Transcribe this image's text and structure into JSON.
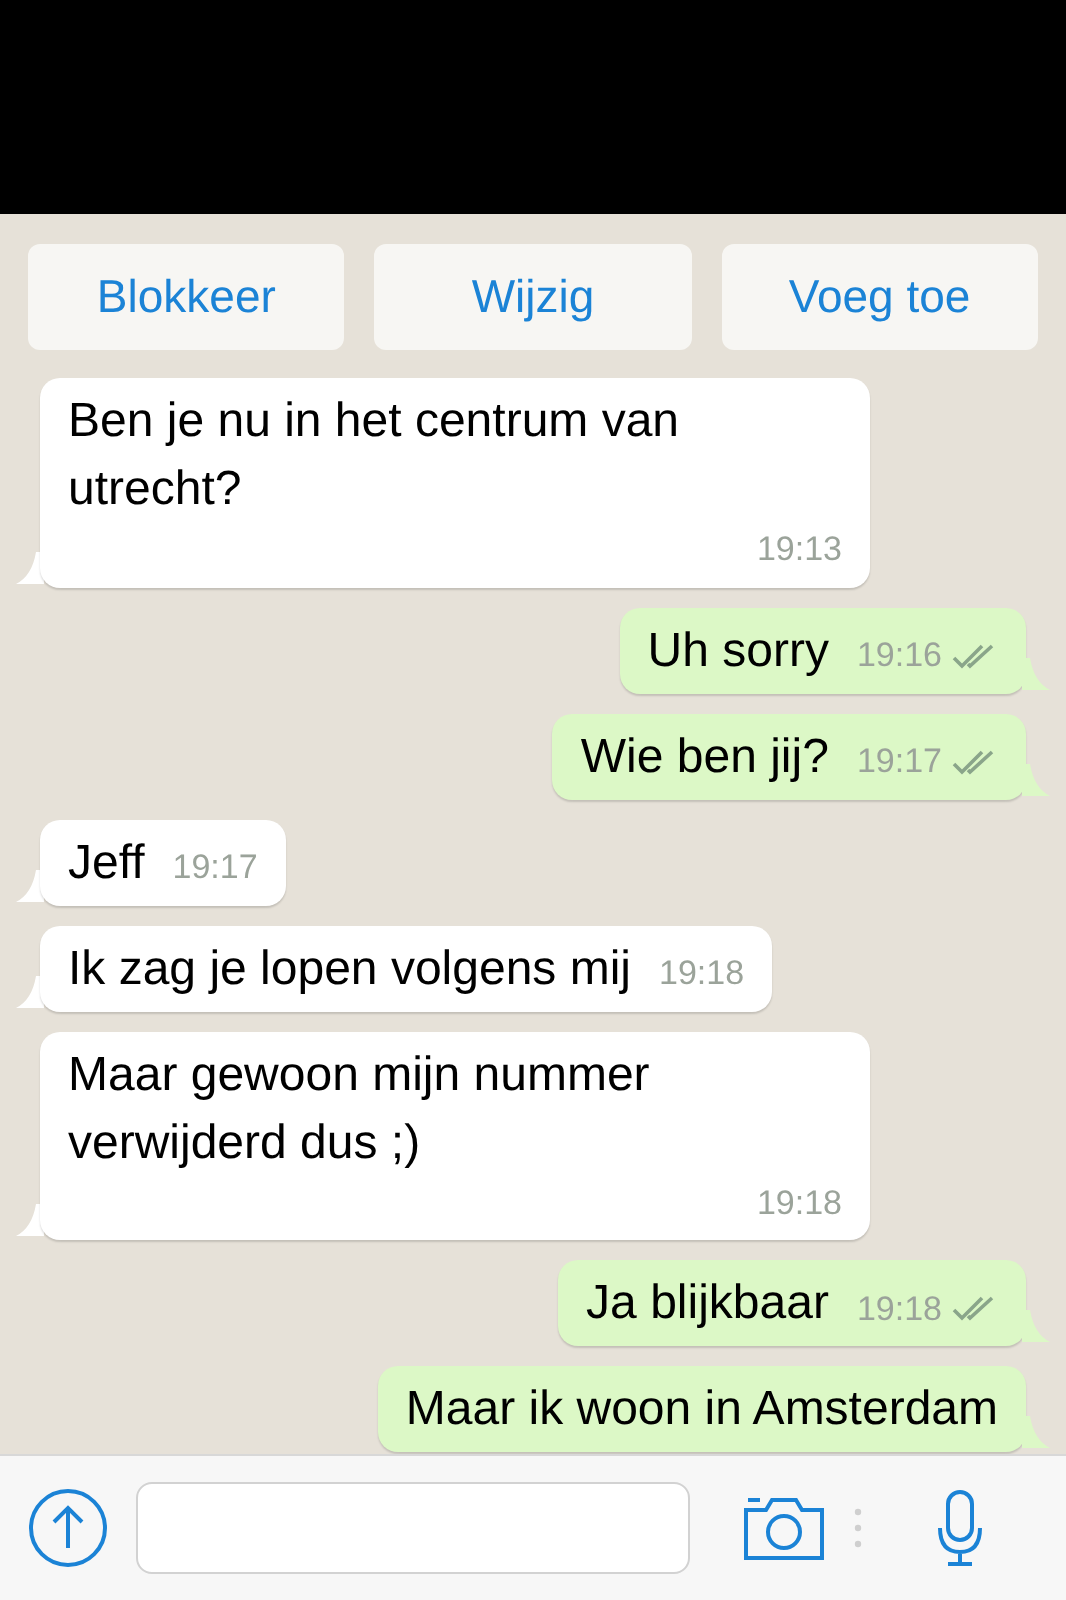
{
  "actions": [
    {
      "label": "Blokkeer"
    },
    {
      "label": "Wijzig"
    },
    {
      "label": "Voeg toe"
    }
  ],
  "messages": [
    {
      "kind": "in",
      "text": "Ben je nu in het centrum van utrecht?",
      "time": "19:13"
    },
    {
      "kind": "out",
      "text": "Uh sorry",
      "time": "19:16",
      "read": true
    },
    {
      "kind": "out",
      "text": "Wie ben jij?",
      "time": "19:17",
      "read": true
    },
    {
      "kind": "in",
      "text": "Jeff",
      "time": "19:17"
    },
    {
      "kind": "in",
      "text": "Ik zag je lopen volgens mij",
      "time": "19:18"
    },
    {
      "kind": "in",
      "text": "Maar gewoon mijn nummer verwijderd dus ;)",
      "time": "19:18"
    },
    {
      "kind": "out",
      "text": "Ja blijkbaar",
      "time": "19:18",
      "read": true
    },
    {
      "kind": "out",
      "text": "Maar ik woon in Amsterdam"
    }
  ]
}
